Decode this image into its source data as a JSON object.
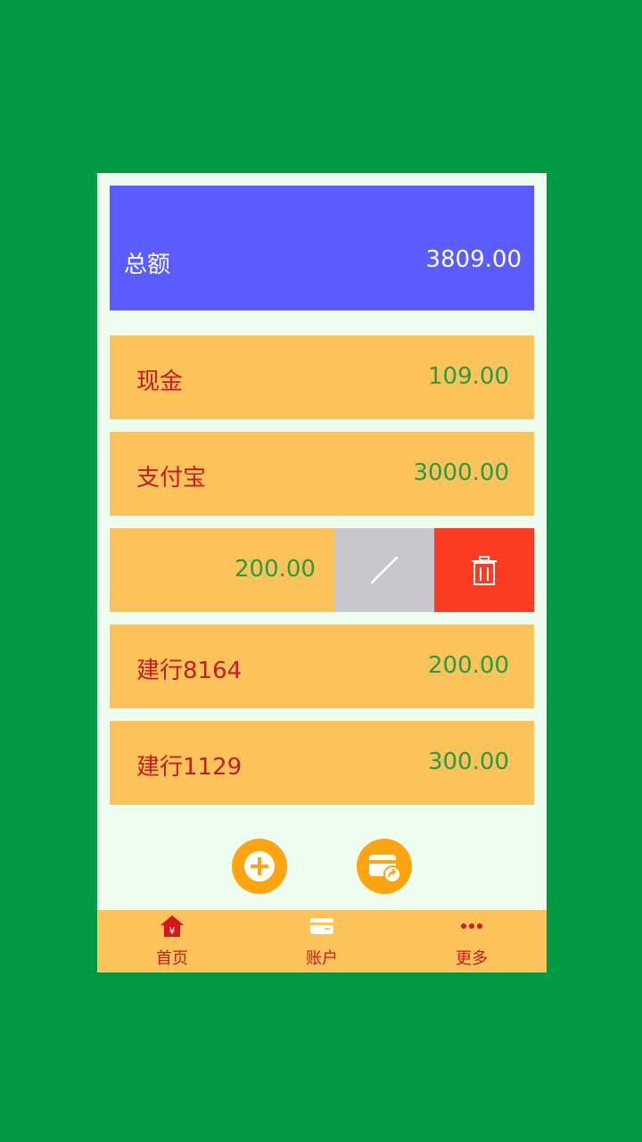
{
  "summary": {
    "label": "总额",
    "amount": "3809.00"
  },
  "accounts": [
    {
      "name": "现金",
      "amount": "109.00"
    },
    {
      "name": "支付宝",
      "amount": "3000.00"
    },
    {
      "name": "",
      "amount": "200.00"
    },
    {
      "name": "建行8164",
      "amount": "200.00"
    },
    {
      "name": "建行1129",
      "amount": "300.00"
    }
  ],
  "swipe_actions": {
    "edit_icon": "pencil-icon",
    "delete_icon": "trash-icon"
  },
  "actions": {
    "add_icon": "plus-circle-icon",
    "transfer_icon": "card-transfer-icon"
  },
  "tabs": [
    {
      "label": "首页",
      "icon": "home-yen-icon"
    },
    {
      "label": "账户",
      "icon": "card-icon"
    },
    {
      "label": "更多",
      "icon": "more-dots-icon"
    }
  ],
  "colors": {
    "background": "#009a44",
    "summary": "#5a5cff",
    "row": "#fcc35a",
    "name_text": "#c41d1d",
    "amount_text": "#2a9a45",
    "delete": "#fa3c23",
    "edit": "#c8c7cc",
    "fab": "#fca510"
  }
}
